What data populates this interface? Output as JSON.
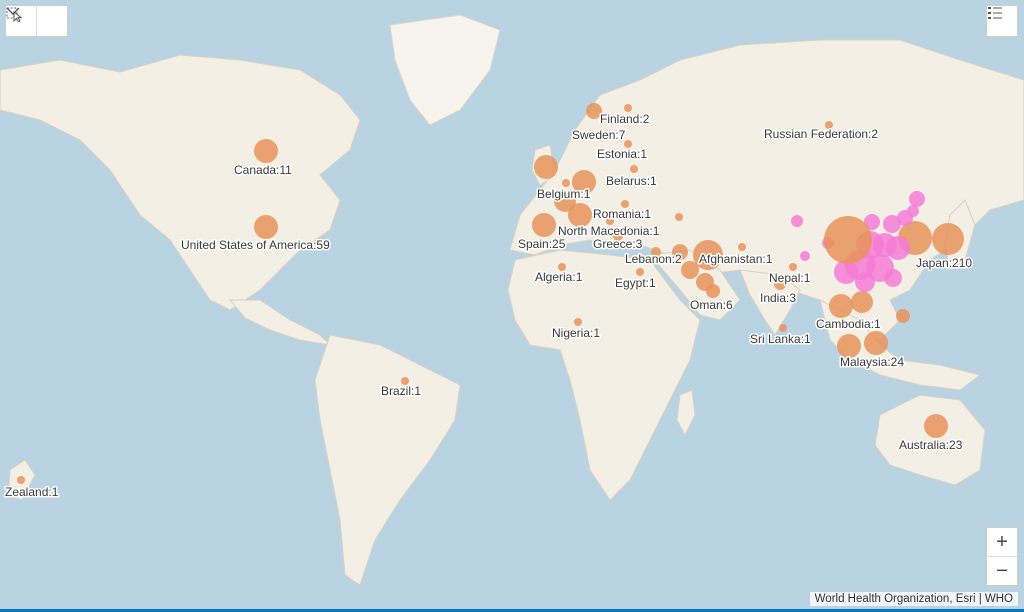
{
  "map": {
    "controls": {
      "select_tool": "select-icon",
      "dropdown": "chevron-down-icon",
      "legend": "legend-list-icon",
      "zoom_in": "+",
      "zoom_out": "−"
    },
    "attribution": "World Health Organization, Esri | WHO",
    "colors": {
      "cases_outside": "#e8935c",
      "cases_china": "#f57bd6",
      "water": "#b9d3e3",
      "land": "#f4efe4"
    },
    "labels": [
      {
        "name": "canada",
        "text": "Canada:11"
      },
      {
        "name": "usa",
        "text": "United States of America:59"
      },
      {
        "name": "brazil",
        "text": "Brazil:1"
      },
      {
        "name": "new-zealand",
        "text": "Zealand:1"
      },
      {
        "name": "finland",
        "text": "Finland:2"
      },
      {
        "name": "sweden",
        "text": "Sweden:7"
      },
      {
        "name": "estonia",
        "text": "Estonia:1"
      },
      {
        "name": "belarus",
        "text": "Belarus:1"
      },
      {
        "name": "belgium",
        "text": "Belgium:1"
      },
      {
        "name": "romania",
        "text": "Romania:1"
      },
      {
        "name": "north-macedonia",
        "text": "North Macedonia:1"
      },
      {
        "name": "spain",
        "text": "Spain:25"
      },
      {
        "name": "greece",
        "text": "Greece:3"
      },
      {
        "name": "lebanon",
        "text": "Lebanon:2"
      },
      {
        "name": "afghanistan",
        "text": "Afghanistan:1"
      },
      {
        "name": "algeria",
        "text": "Algeria:1"
      },
      {
        "name": "egypt",
        "text": "Egypt:1"
      },
      {
        "name": "oman",
        "text": "Oman:6"
      },
      {
        "name": "nigeria",
        "text": "Nigeria:1"
      },
      {
        "name": "russia",
        "text": "Russian Federation:2"
      },
      {
        "name": "nepal",
        "text": "Nepal:1"
      },
      {
        "name": "india",
        "text": "India:3"
      },
      {
        "name": "sri-lanka",
        "text": "Sri Lanka:1"
      },
      {
        "name": "cambodia",
        "text": "Cambodia:1"
      },
      {
        "name": "malaysia",
        "text": "Malaysia:24"
      },
      {
        "name": "japan",
        "text": "Japan:210"
      },
      {
        "name": "australia",
        "text": "Australia:23"
      }
    ]
  }
}
